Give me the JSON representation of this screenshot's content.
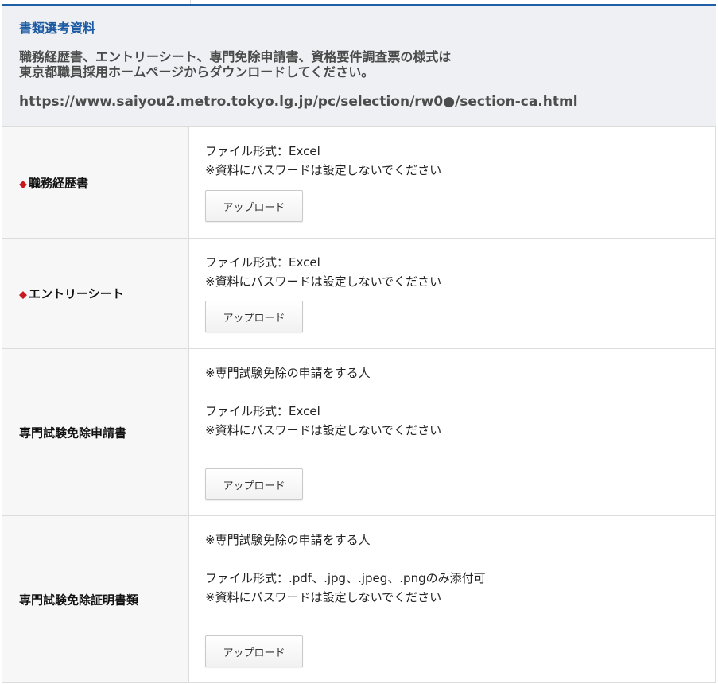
{
  "notice": {
    "title": "書類選考資料",
    "body_line1": "職務経歴書、エントリーシート、専門免除申請書、資格要件調査票の様式は",
    "body_line2": "東京都職員採用ホームページからダウンロードしてください。",
    "link": "https://www.saiyou2.metro.tokyo.lg.jp/pc/selection/rw0●/section-ca.html"
  },
  "rows": [
    {
      "label": "職務経歴書",
      "required": true,
      "condition": "",
      "format": "ファイル形式：Excel",
      "note": "※資料にパスワードは設定しないでください",
      "button": "アップロード"
    },
    {
      "label": "エントリーシート",
      "required": true,
      "condition": "",
      "format": "ファイル形式：Excel",
      "note": "※資料にパスワードは設定しないでください",
      "button": "アップロード"
    },
    {
      "label": "専門試験免除申請書",
      "required": false,
      "condition": "※専門試験免除の申請をする人",
      "format": "ファイル形式：Excel",
      "note": "※資料にパスワードは設定しないでください",
      "button": "アップロード"
    },
    {
      "label": "専門試験免除証明書類",
      "required": false,
      "condition": "※専門試験免除の申請をする人",
      "format": "ファイル形式：.pdf、.jpg、.jpeg、.pngのみ添付可",
      "note": "※資料にパスワードは設定しないでください",
      "button": "アップロード"
    }
  ],
  "required_marker": "◆",
  "colors": {
    "accent": "#1e5fa8",
    "required_marker": "#c8191e",
    "notice_background": "#eef0f3"
  }
}
